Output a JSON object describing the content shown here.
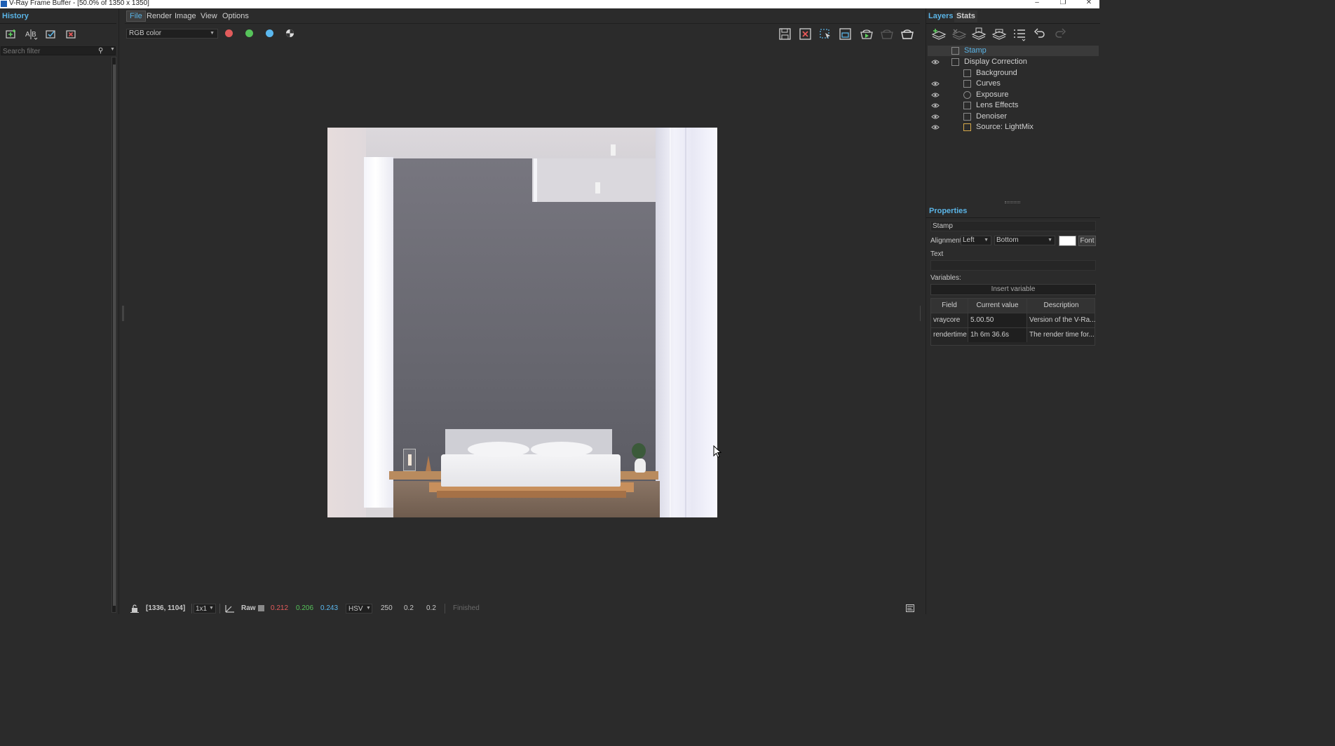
{
  "window": {
    "title": "V-Ray Frame Buffer - [50.0% of 1350 x 1350]",
    "minimize": "–",
    "maximize": "❐",
    "close": "✕"
  },
  "history": {
    "tab_label": "History",
    "search_placeholder": "Search filter"
  },
  "menu": {
    "file": "File",
    "render": "Render",
    "image": "Image",
    "view": "View",
    "options": "Options"
  },
  "toolbar": {
    "channel": "RGB color",
    "colors": {
      "red": "#e15b5b",
      "green": "#56c35a",
      "blue": "#5bb8ef"
    }
  },
  "statusbar": {
    "coords": "[1336, 1104]",
    "zoom": "1x1",
    "mode": "Raw",
    "r": "0.212",
    "g": "0.206",
    "b": "0.243",
    "color_space": "HSV",
    "h": "250",
    "s": "0.2",
    "v": "0.2",
    "status": "Finished",
    "colors": {
      "r": "#e15b5b",
      "g": "#56c35a",
      "b": "#5bb8ef"
    }
  },
  "layers": {
    "tab_layers": "Layers",
    "tab_stats": "Stats",
    "items": [
      {
        "name": "Stamp",
        "visible": false,
        "icon": "stamp-icon"
      },
      {
        "name": "Display Correction",
        "visible": true,
        "icon": "curve-icon"
      },
      {
        "name": "Background",
        "visible": false,
        "icon": "background-icon"
      },
      {
        "name": "Curves",
        "visible": true,
        "icon": "curves-icon"
      },
      {
        "name": "Exposure",
        "visible": true,
        "icon": "exposure-icon"
      },
      {
        "name": "Lens Effects",
        "visible": true,
        "icon": "lens-effects-icon"
      },
      {
        "name": "Denoiser",
        "visible": true,
        "icon": "denoiser-icon"
      },
      {
        "name": "Source: LightMix",
        "visible": true,
        "icon": "lightmix-icon"
      }
    ]
  },
  "properties": {
    "tab_label": "Properties",
    "layer_name": "Stamp",
    "alignment_label": "Alignment",
    "alignment_h": "Left",
    "alignment_v": "Bottom",
    "font_label": "Font",
    "text_label": "Text",
    "variables_label": "Variables:",
    "insert_variable": "Insert variable",
    "table": {
      "headers": [
        "Field",
        "Current value",
        "Description"
      ],
      "rows": [
        [
          "vraycore",
          "5.00.50",
          "Version of the V-Ra..."
        ],
        [
          "rendertime",
          "1h  6m 36.6s",
          "The render time for..."
        ]
      ]
    }
  }
}
